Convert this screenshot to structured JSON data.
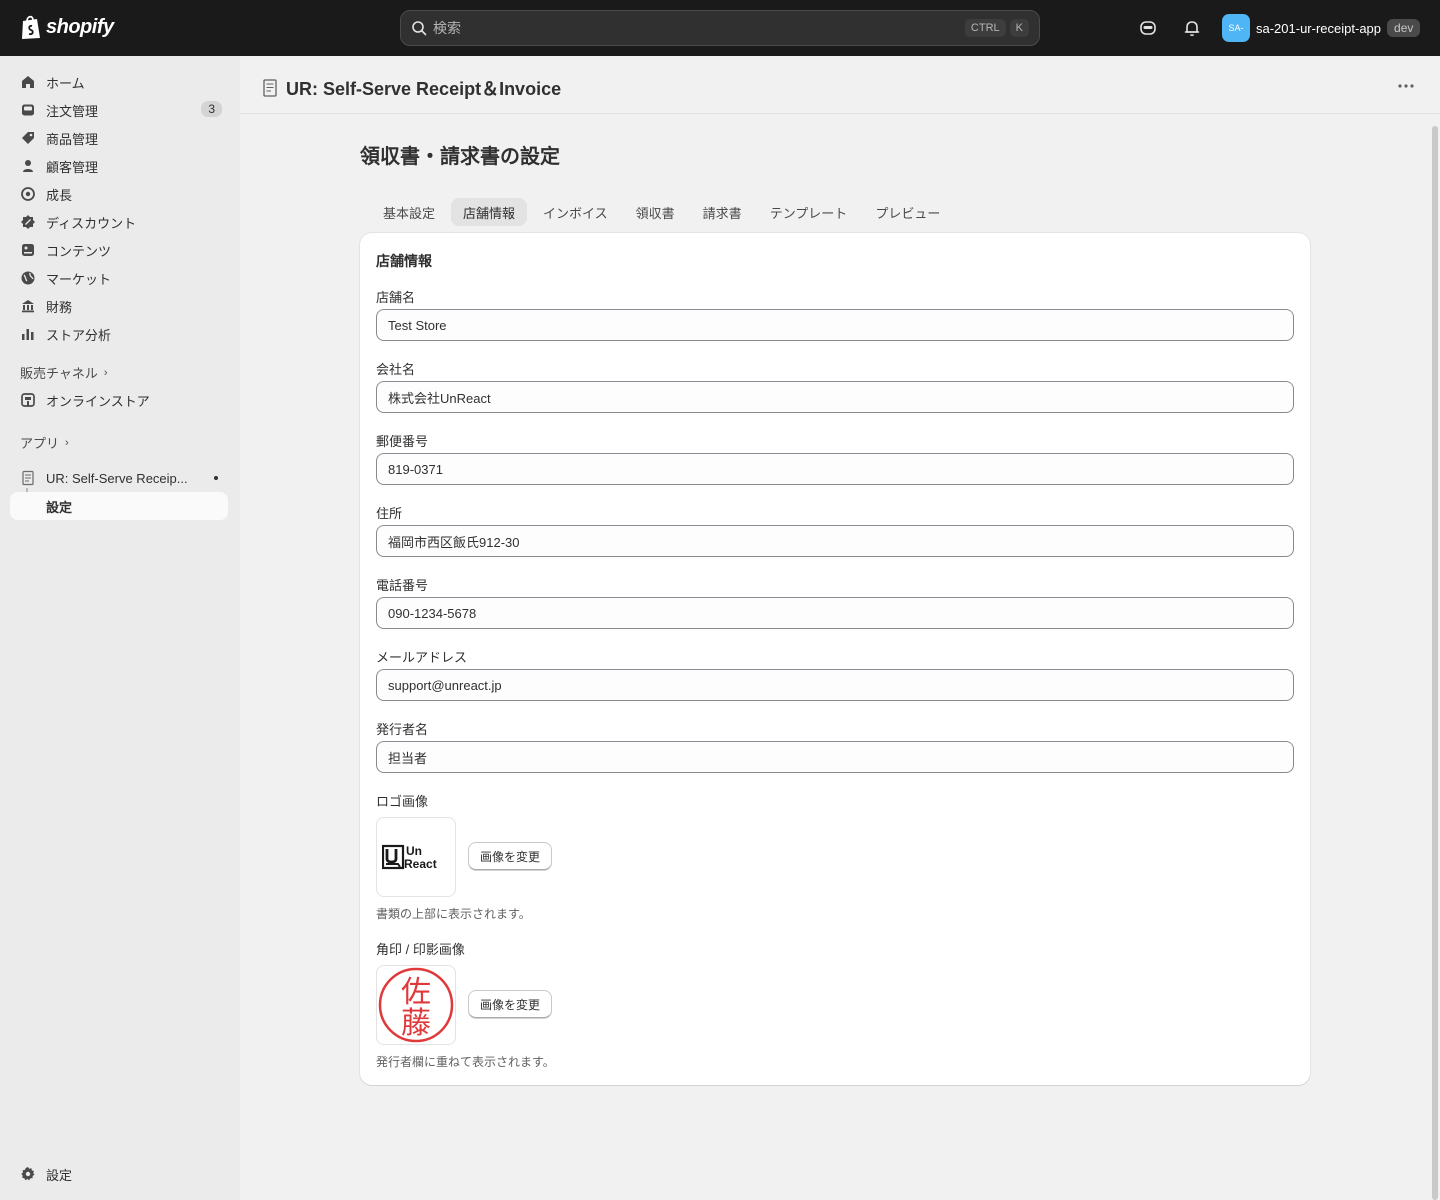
{
  "topbar": {
    "brand": "shopify",
    "search_placeholder": "検索",
    "shortcut_key1": "CTRL",
    "shortcut_key2": "K",
    "store_avatar": "SA-",
    "store_name": "sa-201-ur-receipt-app",
    "store_badge": "dev"
  },
  "sidebar": {
    "items": [
      {
        "label": "ホーム",
        "icon": "home-icon"
      },
      {
        "label": "注文管理",
        "icon": "inbox-icon",
        "badge": "3"
      },
      {
        "label": "商品管理",
        "icon": "tag-icon"
      },
      {
        "label": "顧客管理",
        "icon": "person-icon"
      },
      {
        "label": "成長",
        "icon": "target-icon"
      },
      {
        "label": "ディスカウント",
        "icon": "discount-icon"
      },
      {
        "label": "コンテンツ",
        "icon": "content-icon"
      },
      {
        "label": "マーケット",
        "icon": "globe-icon"
      },
      {
        "label": "財務",
        "icon": "bank-icon"
      },
      {
        "label": "ストア分析",
        "icon": "chart-icon"
      }
    ],
    "sales_channels_label": "販売チャネル",
    "online_store_label": "オンラインストア",
    "apps_label": "アプリ",
    "app_name": "UR: Self-Serve Receip...",
    "app_sub_item": "設定",
    "settings_label": "設定"
  },
  "header": {
    "app_title": "UR: Self-Serve Receipt＆Invoice"
  },
  "page": {
    "title": "領収書・請求書の設定",
    "tabs": [
      "基本設定",
      "店舗情報",
      "インボイス",
      "領収書",
      "請求書",
      "テンプレート",
      "プレビュー"
    ],
    "active_tab": "店舗情報"
  },
  "form": {
    "card_title": "店舗情報",
    "fields": [
      {
        "label": "店舗名",
        "value": "Test Store"
      },
      {
        "label": "会社名",
        "value": "株式会社UnReact"
      },
      {
        "label": "郵便番号",
        "value": "819-0371"
      },
      {
        "label": "住所",
        "value": "福岡市西区飯氏912-30"
      },
      {
        "label": "電話番号",
        "value": "090-1234-5678"
      },
      {
        "label": "メールアドレス",
        "value": "support@unreact.jp"
      },
      {
        "label": "発行者名",
        "value": "担当者"
      }
    ],
    "logo": {
      "label": "ロゴ画像",
      "logo_text_top": "Un",
      "logo_text_bottom": "React",
      "button": "画像を変更",
      "help": "書類の上部に表示されます。"
    },
    "seal": {
      "label": "角印 / 印影画像",
      "seal_text_top": "佐",
      "seal_text_bottom": "藤",
      "button": "画像を変更",
      "help": "発行者欄に重ねて表示されます。"
    }
  },
  "colors": {
    "topbar_bg": "#1a1a1a",
    "avatar_bg": "#4fb5f5",
    "seal_red": "#e0393b"
  }
}
